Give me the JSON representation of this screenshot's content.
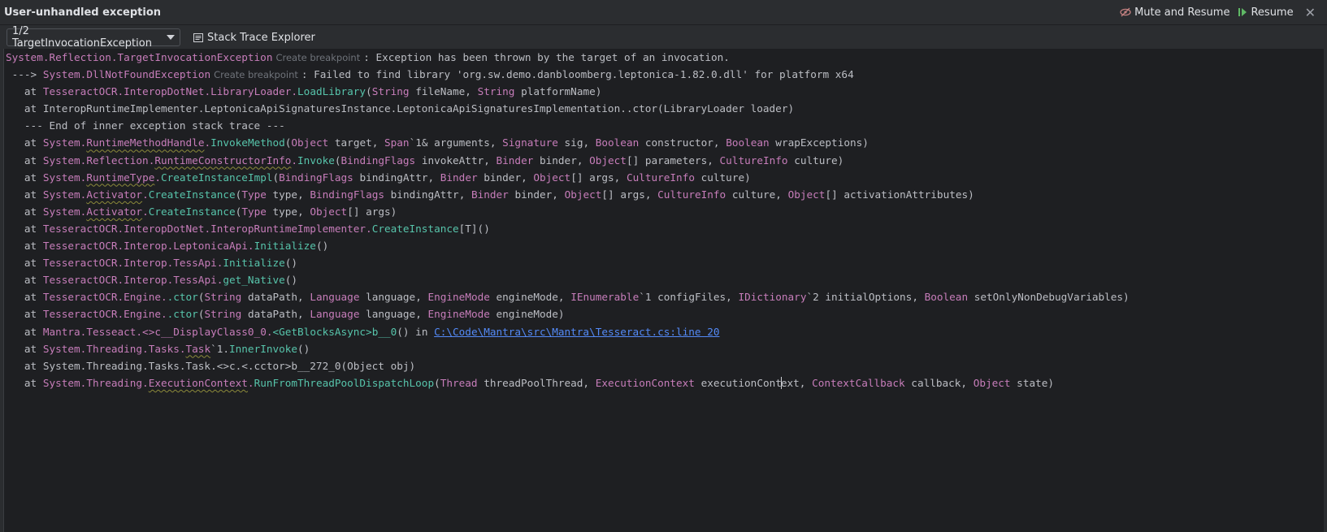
{
  "window": {
    "title": "User-unhandled exception",
    "mute_label": "Mute and Resume",
    "resume_label": "Resume",
    "close_label": "✕"
  },
  "toolbar": {
    "exception_select": "1/2 TargetInvocationException",
    "stack_trace_explorer": "Stack Trace Explorer"
  },
  "trace": {
    "create_breakpoint": "Create breakpoint",
    "l1": {
      "ns": "System.Reflection.",
      "type": "TargetInvocationException",
      "msg": ": Exception has been thrown by the target of an invocation."
    },
    "l2": {
      "prefix": " ---> ",
      "ns": "System.",
      "type": "DllNotFoundException",
      "msg": ": Failed to find library 'org.sw.demo.danbloomberg.leptonica-1.82.0.dll' for platform x64"
    },
    "l3": {
      "at": "   at ",
      "a": "TesseractOCR.InteropDotNet.",
      "b": "LibraryLoader",
      "c": ".",
      "m": "LoadLibrary",
      "p1": "(",
      "t1": "String",
      "s1": " fileName, ",
      "t2": "String",
      "s2": " platformName)"
    },
    "l4": {
      "text": "   at InteropRuntimeImplementer.LeptonicaApiSignaturesInstance.LeptonicaApiSignaturesImplementation..ctor(LibraryLoader loader)"
    },
    "l5": {
      "text": "   --- End of inner exception stack trace ---"
    },
    "l6": {
      "at": "   at ",
      "a": "System.",
      "b": "RuntimeMethodHandle",
      "c": ".",
      "m": "InvokeMethod",
      "p": "(",
      "t1": "Object",
      "s1": " target, ",
      "t2": "Span",
      "s2": "`1& arguments, ",
      "t3": "Signature",
      "s3": " sig, ",
      "t4": "Boolean",
      "s4": " constructor, ",
      "t5": "Boolean",
      "s5": " wrapExceptions)"
    },
    "l7": {
      "at": "   at ",
      "a": "System.Reflection.",
      "b": "RuntimeConstructorInfo",
      "c": ".",
      "m": "Invoke",
      "p": "(",
      "t1": "BindingFlags",
      "s1": " invokeAttr, ",
      "t2": "Binder",
      "s2": " binder, ",
      "t3": "Object",
      "s3": "[] parameters, ",
      "t4": "CultureInfo",
      "s4": " culture)"
    },
    "l8": {
      "at": "   at ",
      "a": "System.",
      "b": "RuntimeType",
      "c": ".",
      "m": "CreateInstanceImpl",
      "p": "(",
      "t1": "BindingFlags",
      "s1": " bindingAttr, ",
      "t2": "Binder",
      "s2": " binder, ",
      "t3": "Object",
      "s3": "[] args, ",
      "t4": "CultureInfo",
      "s4": " culture)"
    },
    "l9": {
      "at": "   at ",
      "a": "System.",
      "b": "Activator",
      "c": ".",
      "m": "CreateInstance",
      "p": "(",
      "t1": "Type",
      "s1": " type, ",
      "t2": "BindingFlags",
      "s2": " bindingAttr, ",
      "t3": "Binder",
      "s3": " binder, ",
      "t4": "Object",
      "s4": "[] args, ",
      "t5": "CultureInfo",
      "s5": " culture, ",
      "t6": "Object",
      "s6": "[] activationAttributes)"
    },
    "l10": {
      "at": "   at ",
      "a": "System.",
      "b": "Activator",
      "c": ".",
      "m": "CreateInstance",
      "p": "(",
      "t1": "Type",
      "s1": " type, ",
      "t2": "Object",
      "s2": "[] args)"
    },
    "l11": {
      "at": "   at ",
      "a": "TesseractOCR.InteropDotNet.InteropRuntimeImplementer.",
      "m": "CreateInstance",
      "s": "[T]()"
    },
    "l12": {
      "at": "   at ",
      "a": "TesseractOCR.Interop.LeptonicaApi.",
      "m": "Initialize",
      "s": "()"
    },
    "l13": {
      "at": "   at ",
      "a": "TesseractOCR.Interop.TessApi.",
      "m": "Initialize",
      "s": "()"
    },
    "l14": {
      "at": "   at ",
      "a": "TesseractOCR.Interop.TessApi.",
      "m": "get_Native",
      "s": "()"
    },
    "l15": {
      "at": "   at ",
      "a": "TesseractOCR.Engine.",
      "m": ".ctor",
      "p": "(",
      "t1": "String",
      "s1": " dataPath, ",
      "t2": "Language",
      "s2": " language, ",
      "t3": "EngineMode",
      "s3": " engineMode, ",
      "t4": "IEnumerable",
      "s4": "`1 configFiles, ",
      "t5": "IDictionary",
      "s5": "`2 initialOptions, ",
      "t6": "Boolean",
      "s6": " setOnlyNonDebugVariables)"
    },
    "l16": {
      "at": "   at ",
      "a": "TesseractOCR.Engine.",
      "m": ".ctor",
      "p": "(",
      "t1": "String",
      "s1": " dataPath, ",
      "t2": "Language",
      "s2": " language, ",
      "t3": "EngineMode",
      "s3": " engineMode)"
    },
    "l17": {
      "at": "   at ",
      "a": "Mantra.Tesseact.<>c__DisplayClass0_0.",
      "m": "<GetBlocksAsync>b__0",
      "s": "() in ",
      "link": "C:\\Code\\Mantra\\src\\Mantra\\Tesseract.cs:line 20"
    },
    "l18": {
      "at": "   at ",
      "a": "System.Threading.Tasks.",
      "b": "Task",
      "c": "`1.",
      "m": "InnerInvoke",
      "s": "()"
    },
    "l19": {
      "text": "   at System.Threading.Tasks.Task.<>c.<.cctor>b__272_0(Object obj)"
    },
    "l20": {
      "at": "   at ",
      "a": "System.Threading.",
      "b": "ExecutionContext",
      "c": ".",
      "m": "RunFromThreadPoolDispatchLoop",
      "p": "(",
      "t1": "Thread",
      "s1": " threadPoolThread, ",
      "t2": "ExecutionContext",
      "s2a": " executionCont",
      "s2b": "ext, ",
      "t3": "ContextCallback",
      "s3": " callback, ",
      "t4": "Object",
      "s4": " state)"
    }
  }
}
